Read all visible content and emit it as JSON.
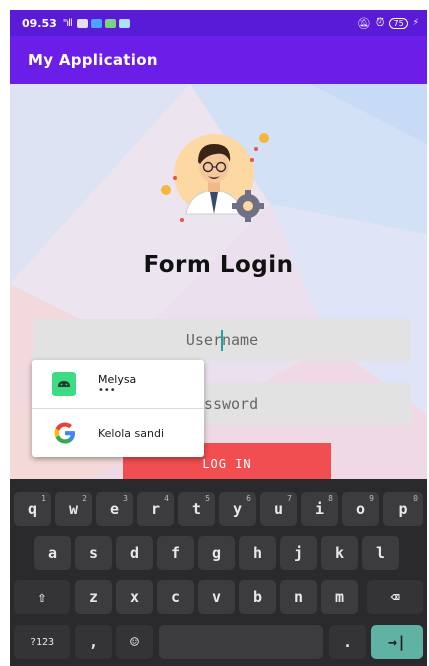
{
  "status_bar": {
    "time": "09.53",
    "signal": "\"ıll",
    "battery": "75"
  },
  "app_bar": {
    "title": "My Application"
  },
  "form": {
    "title": "Form Login",
    "username_placeholder": "Username",
    "password_placeholder": "Password",
    "login_label": "LOG IN"
  },
  "autofill": {
    "account_name": "Melysa",
    "account_masked": "•••",
    "manage_label": "Kelola sandi"
  },
  "keyboard": {
    "row1": [
      {
        "label": "q",
        "hint": "1"
      },
      {
        "label": "w",
        "hint": "2"
      },
      {
        "label": "e",
        "hint": "3"
      },
      {
        "label": "r",
        "hint": "4"
      },
      {
        "label": "t",
        "hint": "5"
      },
      {
        "label": "y",
        "hint": "6"
      },
      {
        "label": "u",
        "hint": "7"
      },
      {
        "label": "i",
        "hint": "8"
      },
      {
        "label": "o",
        "hint": "9"
      },
      {
        "label": "p",
        "hint": "0"
      }
    ],
    "row2": [
      "a",
      "s",
      "d",
      "f",
      "g",
      "h",
      "j",
      "k",
      "l"
    ],
    "row3": [
      "z",
      "x",
      "c",
      "v",
      "b",
      "n",
      "m"
    ],
    "symbols_label": "?123",
    "comma_label": ",",
    "period_label": ".",
    "shift_glyph": "⇧",
    "backspace_glyph": "⌫",
    "enter_glyph": "→|",
    "emoji_glyph": "☺"
  },
  "colors": {
    "status_bar": "#5a1bd8",
    "app_bar": "#6a1ee8",
    "login_button": "#f04e50",
    "field_bg": "#e2e2e2",
    "keyboard_bg": "#2a2a2c",
    "enter_key": "#5fb2a4"
  }
}
